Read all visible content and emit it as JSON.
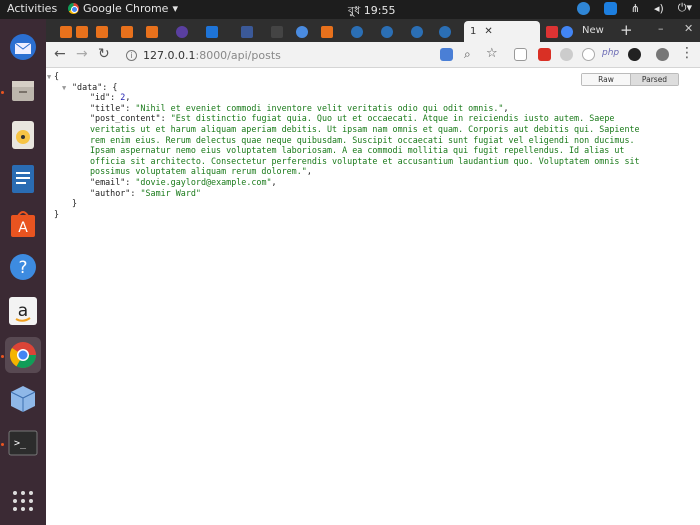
{
  "system": {
    "activities": "Activities",
    "app_name": "Google Chrome",
    "clock": "বুধ 19:55"
  },
  "browser": {
    "active_tab_label": "1",
    "newtab_label": "New",
    "url_host": "127.0.0.1",
    "url_path": ":8000/api/posts",
    "ext_php_label": "php"
  },
  "viewer": {
    "raw_label": "Raw",
    "parsed_label": "Parsed"
  },
  "json": {
    "open": "{",
    "data_key": "\"data\"",
    "data_open": ": {",
    "id_key": "\"id\"",
    "id_val": "2",
    "title_key": "\"title\"",
    "title_val": "\"Nihil et eveniet commodi inventore velit veritatis odio qui odit omnis.\"",
    "post_content_key": "\"post_content\"",
    "post_content_val": "\"Est distinctio fugiat quia. Quo ut et occaecati. Atque in reiciendis iusto autem. Saepe veritatis ut et harum aliquam aperiam debitis. Ut ipsam nam omnis et quam. Corporis aut debitis qui. Sapiente rem enim eius. Rerum delectus quae neque quibusdam. Suscipit occaecati sunt fugiat vel eligendi non ducimus. Ipsam aspernatur nemo eius voluptatem laboriosam. A ea commodi mollitia qui fugit repellendus. Id alias ut officia sit architecto. Consectetur perferendis voluptate et accusantium laudantium quo. Voluptatem omnis sit possimus voluptatem aliquam rerum dolorem.\"",
    "email_key": "\"email\"",
    "email_val": "\"dovie.gaylord@example.com\"",
    "author_key": "\"author\"",
    "author_val": "\"Samir Ward\"",
    "inner_close": "}",
    "close": "}"
  }
}
